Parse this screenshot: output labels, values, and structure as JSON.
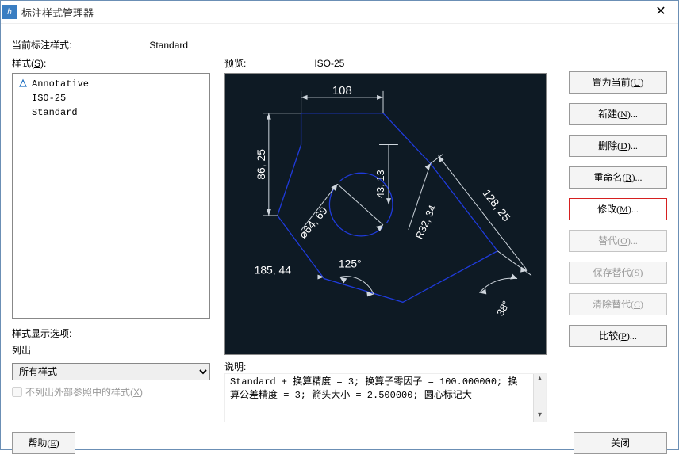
{
  "window": {
    "title": "标注样式管理器"
  },
  "current": {
    "label": "当前标注样式:",
    "value": "Standard"
  },
  "styles": {
    "label": "样式(S):",
    "items": [
      {
        "name": "Annotative",
        "annotative": true
      },
      {
        "name": "ISO-25",
        "annotative": false
      },
      {
        "name": "Standard",
        "annotative": false
      }
    ]
  },
  "preview": {
    "label": "预览:",
    "value": "ISO-25"
  },
  "dims": {
    "w108": "108",
    "h86": "86, 25",
    "r43": "43, 13",
    "d64": "⌀64, 69",
    "ang125": "125°",
    "len185": "185, 44",
    "r32": "R32, 34",
    "diag128": "128, 25",
    "ang38": "38°"
  },
  "display_options": {
    "label": "样式显示选项:",
    "list_label": "列出",
    "selected": "所有样式",
    "chk_label": "不列出外部参照中的样式(X)",
    "chk_checked": false
  },
  "desc": {
    "label": "说明:",
    "text": "Standard + 换算精度 = 3; 换算子零因子 = 100.000000; 换算公差精度 = 3; 箭头大小 = 2.500000; 圆心标记大"
  },
  "buttons": {
    "set_current": "置为当前(U)",
    "new": "新建(N)...",
    "delete": "删除(D)...",
    "rename": "重命名(R)...",
    "modify": "修改(M)...",
    "override": "替代(O)...",
    "save_override": "保存替代(S)",
    "clear_override": "清除替代(C)",
    "compare": "比较(P)...",
    "help": "帮助(E)",
    "close": "关闭"
  }
}
